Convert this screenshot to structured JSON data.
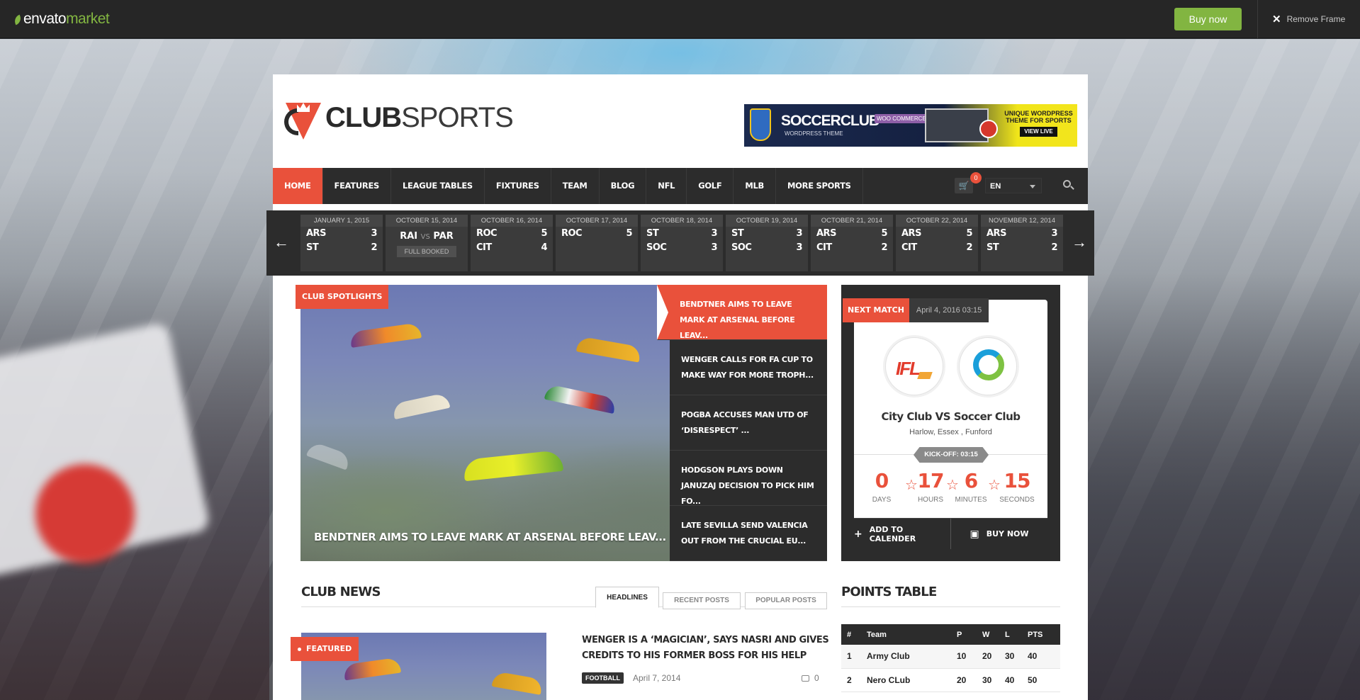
{
  "envato": {
    "logo_main": "envato",
    "logo_accent": "market",
    "buy_label": "Buy now",
    "remove_label": "Remove Frame"
  },
  "site": {
    "brand_bold": "CLUB",
    "brand_light": "SPORTS",
    "banner": {
      "title": "SOCCERCLUB",
      "subtitle": "WORDPRESS THEME",
      "woo": "WOO COMMERCE",
      "tagline": "UNIQUE WORDPRESS THEME FOR SPORTS",
      "cta": "VIEW LIVE"
    }
  },
  "nav": {
    "items": [
      "HOME",
      "FEATURES",
      "LEAGUE TABLES",
      "FIXTURES",
      "TEAM",
      "BLOG",
      "NFL",
      "GOLF",
      "MLB",
      "MORE SPORTS"
    ],
    "cart_count": "0",
    "language": "EN"
  },
  "ticker": {
    "games": [
      {
        "date": "JANUARY 1, 2015",
        "home": "ARS",
        "home_score": "3",
        "away": "ST",
        "away_score": "2"
      },
      {
        "date": "OCTOBER 15, 2014",
        "home": "RAI",
        "vs": "VS",
        "away": "PAR",
        "status": "FULL BOOKED"
      },
      {
        "date": "OCTOBER 16, 2014",
        "home": "ROC",
        "home_score": "5",
        "away": "CIT",
        "away_score": "4"
      },
      {
        "date": "OCTOBER 17, 2014",
        "home": "ROC",
        "home_score": "5",
        "away": "",
        "away_score": ""
      },
      {
        "date": "OCTOBER 18, 2014",
        "home": "ST",
        "home_score": "3",
        "away": "SOC",
        "away_score": "3"
      },
      {
        "date": "OCTOBER 19, 2014",
        "home": "ST",
        "home_score": "3",
        "away": "SOC",
        "away_score": "3"
      },
      {
        "date": "OCTOBER 21, 2014",
        "home": "ARS",
        "home_score": "5",
        "away": "CIT",
        "away_score": "2"
      },
      {
        "date": "OCTOBER 22, 2014",
        "home": "ARS",
        "home_score": "5",
        "away": "CIT",
        "away_score": "2"
      },
      {
        "date": "NOVEMBER 12, 2014",
        "home": "ARS",
        "home_score": "3",
        "away": "ST",
        "away_score": "2"
      }
    ]
  },
  "spotlight": {
    "label": "CLUB SPOTLIGHTS",
    "caption": "BENDTNER AIMS TO LEAVE MARK AT ARSENAL BEFORE LEAV...",
    "list": [
      "BENDTNER AIMS TO LEAVE MARK AT ARSENAL BEFORE LEAV...",
      "WENGER CALLS FOR FA CUP TO MAKE WAY FOR MORE TROPH...",
      "POGBA ACCUSES MAN UTD OF ‘DISRESPECT’ ...",
      "HODGSON PLAYS DOWN JANUZAJ DECISION TO PICK HIM FO...",
      "LATE SEVILLA SEND VALENCIA OUT FROM THE CRUCIAL EU..."
    ]
  },
  "next_match": {
    "label": "NEXT MATCH",
    "date": "April 4, 2016 03:15",
    "team_a_logo": "IFL",
    "title": "City Club VS Soccer Club",
    "location": "Harlow, Essex , Funford",
    "kickoff": "KICK-OFF: 03:15",
    "countdown": {
      "days": "0",
      "days_label": "DAYS",
      "hours": "17",
      "hours_label": "HOURS",
      "minutes": "6",
      "minutes_label": "MINUTES",
      "seconds": "15",
      "seconds_label": "SECONDS"
    },
    "add_calendar": "ADD TO CALENDER",
    "buy_now": "BUY NOW"
  },
  "club_news": {
    "title": "CLUB NEWS",
    "tabs": [
      "HEADLINES",
      "RECENT POSTS",
      "POPULAR POSTS"
    ],
    "featured_label": "FEATURED",
    "article": {
      "title": "WENGER IS A ‘MAGICIAN’, SAYS NASRI AND GIVES CREDITS TO HIS FORMER BOSS FOR HIS HELP",
      "category": "FOOTBALL",
      "date": "April 7, 2014",
      "comments": "0"
    }
  },
  "points_table": {
    "title": "POINTS TABLE",
    "headers": [
      "#",
      "Team",
      "P",
      "W",
      "L",
      "PTS"
    ],
    "rows": [
      [
        "1",
        "Army Club",
        "10",
        "20",
        "30",
        "40"
      ],
      [
        "2",
        "Nero CLub",
        "20",
        "30",
        "40",
        "50"
      ]
    ]
  },
  "colors": {
    "accent": "#e9513b",
    "envato_green": "#82b541",
    "dark": "#2c2c2c"
  }
}
